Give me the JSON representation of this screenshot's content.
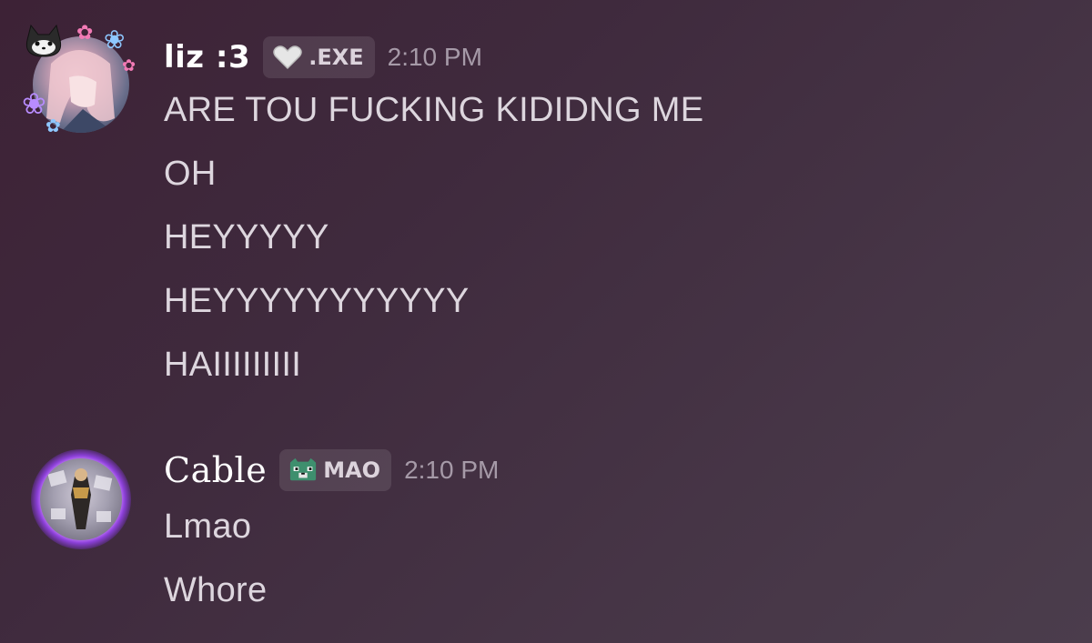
{
  "messages": [
    {
      "username": "liz :3",
      "tag": ".EXE",
      "timestamp": "2:10 PM",
      "lines": [
        "ARE TOU FUCKING KIDIDNG ME",
        "OH",
        "HEYYYYY",
        "HEYYYYYYYYYYY",
        "HAIIIIIIIII"
      ]
    },
    {
      "username": "Cable",
      "tag": "MAO",
      "timestamp": "2:10 PM",
      "lines": [
        "Lmao",
        "Whore"
      ]
    }
  ],
  "colors": {
    "username": "#ffffff",
    "timestamp": "#a69aa8",
    "message_text": "#ddd6de",
    "tag_background": "#5a4a5a",
    "cable_avatar_glow": "#b36cff"
  },
  "icons": {
    "liz_tag": "heart-icon",
    "cable_tag": "cat-face-icon"
  }
}
